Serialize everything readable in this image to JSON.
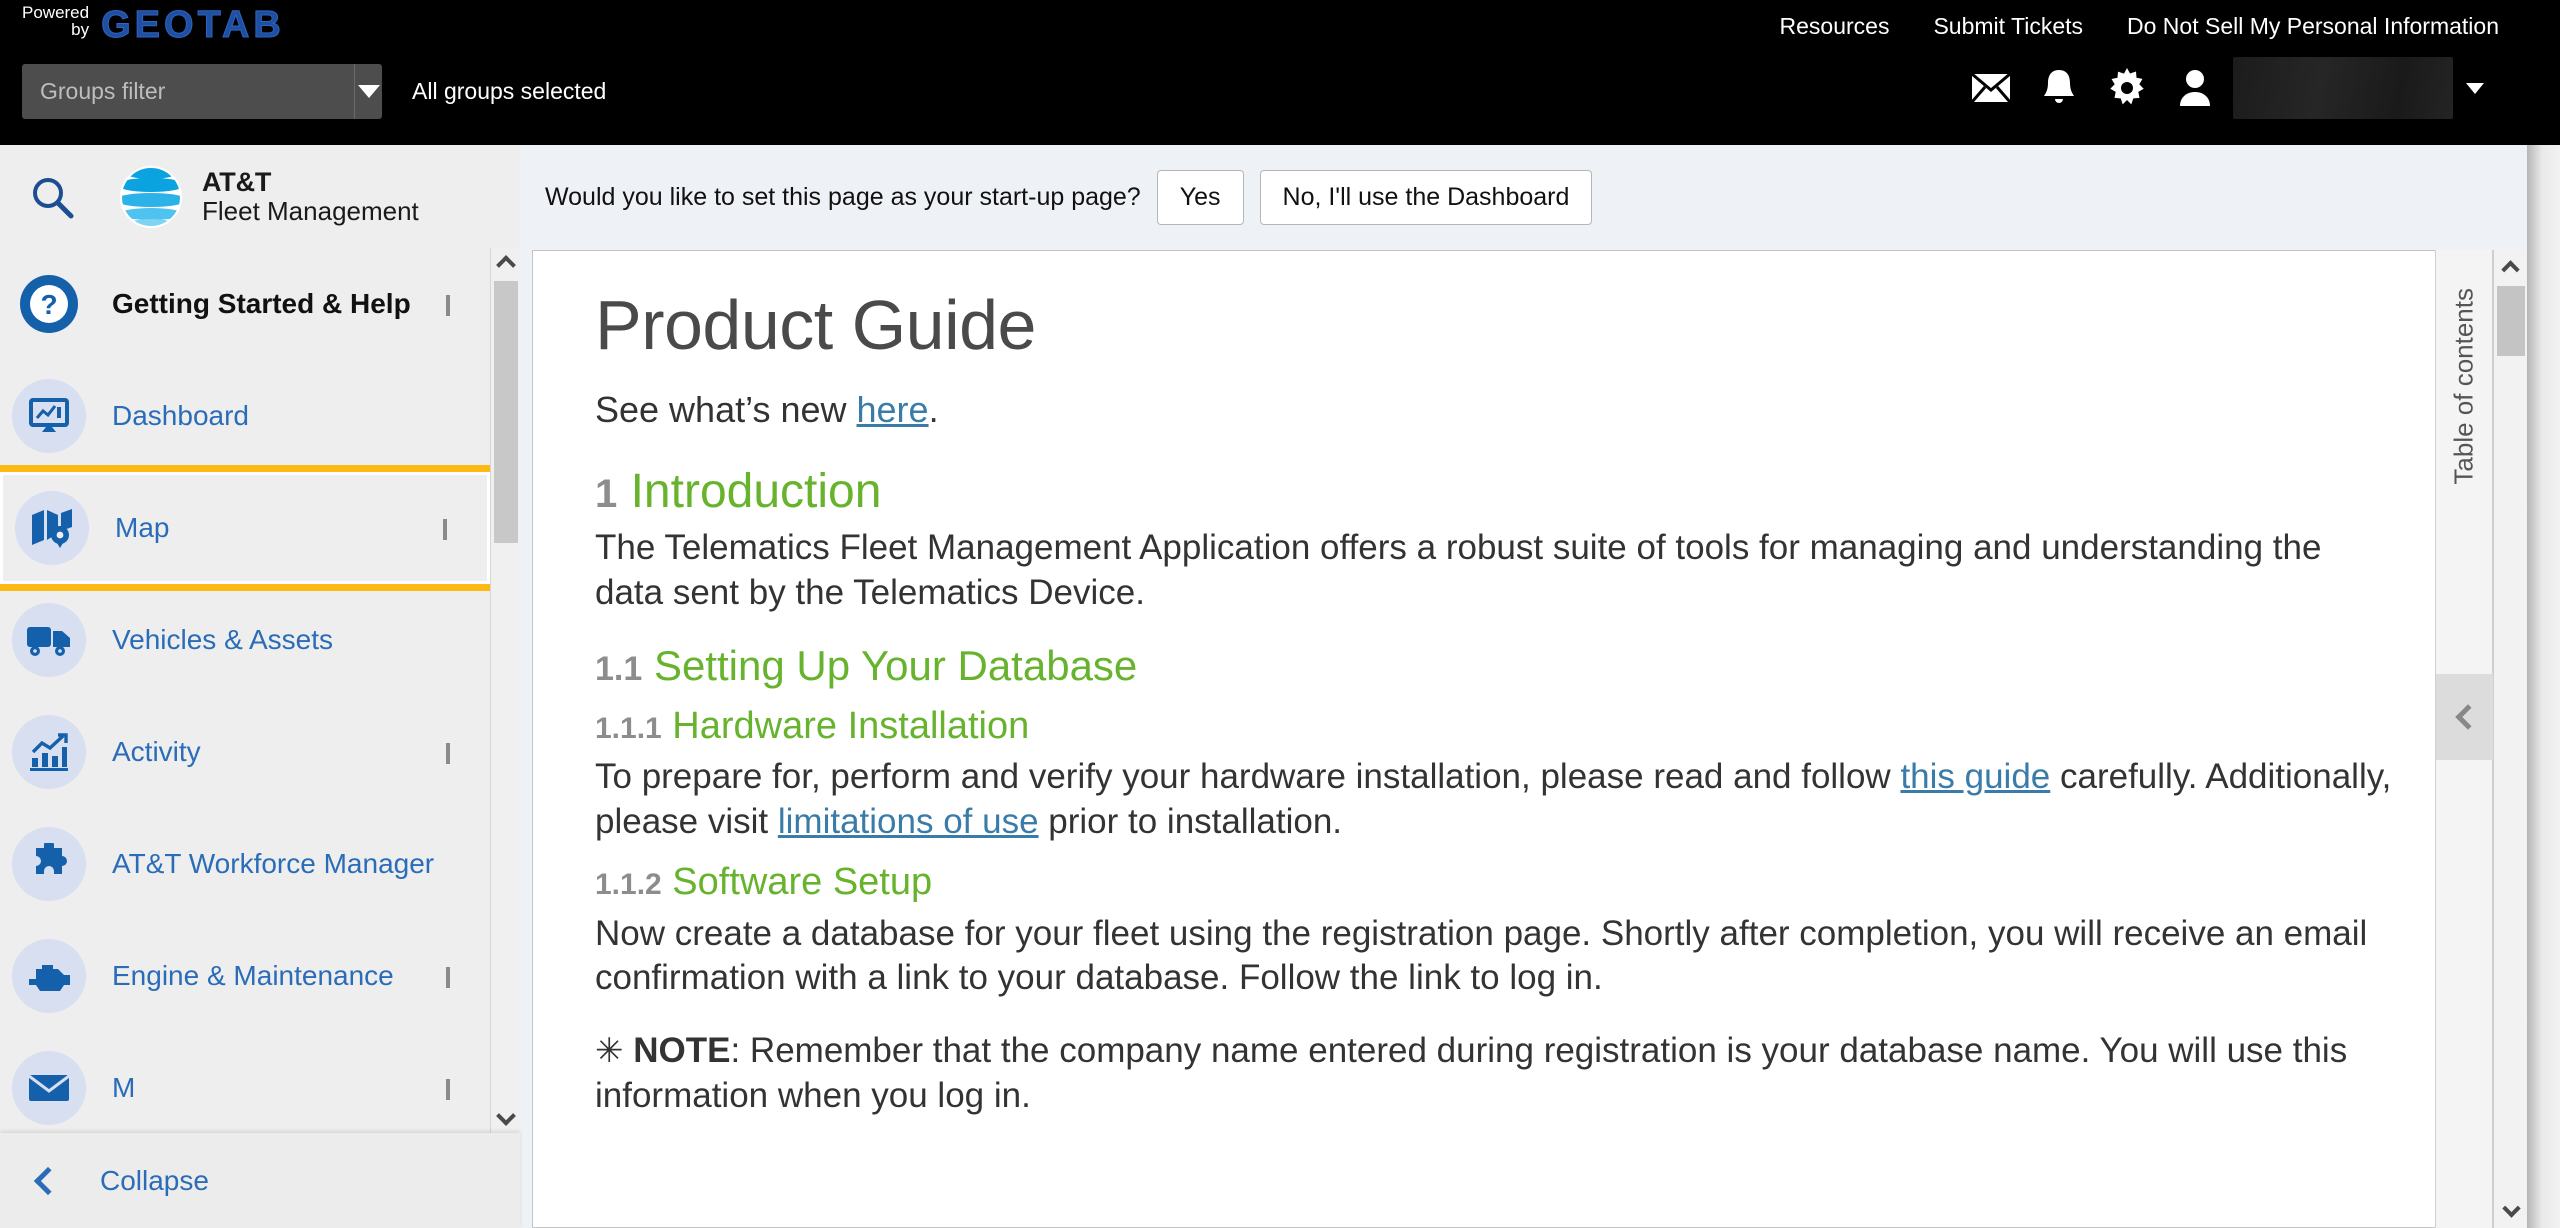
{
  "topbar": {
    "brand_powered": "Powered",
    "brand_by": "by",
    "brand_name": "GEOTAB",
    "links": [
      {
        "label": "Resources"
      },
      {
        "label": "Submit Tickets"
      },
      {
        "label": "Do Not Sell My Personal Information"
      }
    ],
    "groups_filter_placeholder": "Groups filter",
    "groups_filter_value": "",
    "groups_selected_text": "All groups selected",
    "icons": [
      {
        "name": "mail-icon"
      },
      {
        "name": "bell-icon"
      },
      {
        "name": "gear-icon"
      },
      {
        "name": "user-icon"
      }
    ],
    "user_name": ""
  },
  "sidebar": {
    "search_icon": "search-icon",
    "brand_line1": "AT&T",
    "brand_line2": "Fleet Management",
    "items": [
      {
        "label": "Getting Started & Help",
        "icon": "help-circle-icon",
        "chevron": true,
        "bold": true,
        "highlight": false
      },
      {
        "label": "Dashboard",
        "icon": "dashboard-icon",
        "chevron": false,
        "bold": false,
        "highlight": false
      },
      {
        "label": "Map",
        "icon": "map-icon",
        "chevron": true,
        "bold": false,
        "highlight": true
      },
      {
        "label": "Vehicles & Assets",
        "icon": "truck-icon",
        "chevron": false,
        "bold": false,
        "highlight": false
      },
      {
        "label": "Activity",
        "icon": "chart-icon",
        "chevron": true,
        "bold": false,
        "highlight": false
      },
      {
        "label": "AT&T Workforce Manager",
        "icon": "puzzle-icon",
        "chevron": false,
        "bold": false,
        "highlight": false
      },
      {
        "label": "Engine & Maintenance",
        "icon": "engine-icon",
        "chevron": true,
        "bold": false,
        "highlight": false
      },
      {
        "label": "M",
        "icon": "mail-icon",
        "chevron": true,
        "bold": false,
        "highlight": false
      }
    ],
    "collapse_label": "Collapse",
    "collapse_icon": "chevron-left-icon"
  },
  "startup_prompt": {
    "question": "Would you like to set this page as your start-up page?",
    "yes_label": "Yes",
    "no_label": "No, I'll use the Dashboard"
  },
  "document": {
    "title": "Product Guide",
    "subtitle_prefix": "See what’s new ",
    "subtitle_link": "here",
    "subtitle_suffix": ".",
    "sections": [
      {
        "number": "1",
        "heading": "Introduction",
        "level": 2,
        "paragraph": "The Telematics Fleet Management Application offers a robust suite of tools for managing and understanding the data sent by the Telematics Device."
      },
      {
        "number": "1.1",
        "heading": "Setting Up Your Database",
        "level": 3,
        "paragraph": ""
      },
      {
        "number": "1.1.1",
        "heading": "Hardware Installation",
        "level": 4,
        "paragraph_parts": [
          {
            "type": "text",
            "value": "To prepare for, perform and verify your hardware installation, please read and follow "
          },
          {
            "type": "link",
            "value": "this guide"
          },
          {
            "type": "text",
            "value": " carefully. Additionally, please visit "
          },
          {
            "type": "link",
            "value": "limitations of use"
          },
          {
            "type": "text",
            "value": " prior to installation."
          }
        ]
      },
      {
        "number": "1.1.2",
        "heading": "Software Setup",
        "level": 4,
        "paragraph": "Now create a database for your fleet using the registration page. Shortly after completion, you will receive an email confirmation with a link to your database. Follow the link to log in."
      }
    ],
    "note_star": "✳",
    "note_label": "NOTE",
    "note_text": ": Remember that the company name entered during registration is your database name. You will use this information when you log in."
  },
  "toc": {
    "label": "Table of contents",
    "expand_icon": "chevron-left-icon"
  },
  "colors": {
    "heading_green": "#67b32e",
    "link_blue": "#3a7ca8",
    "nav_blue": "#2b6cb8",
    "highlight_amber": "#fdb913",
    "geotab_blue": "#1f4fa0",
    "att_blue": "#1aa7e8"
  }
}
